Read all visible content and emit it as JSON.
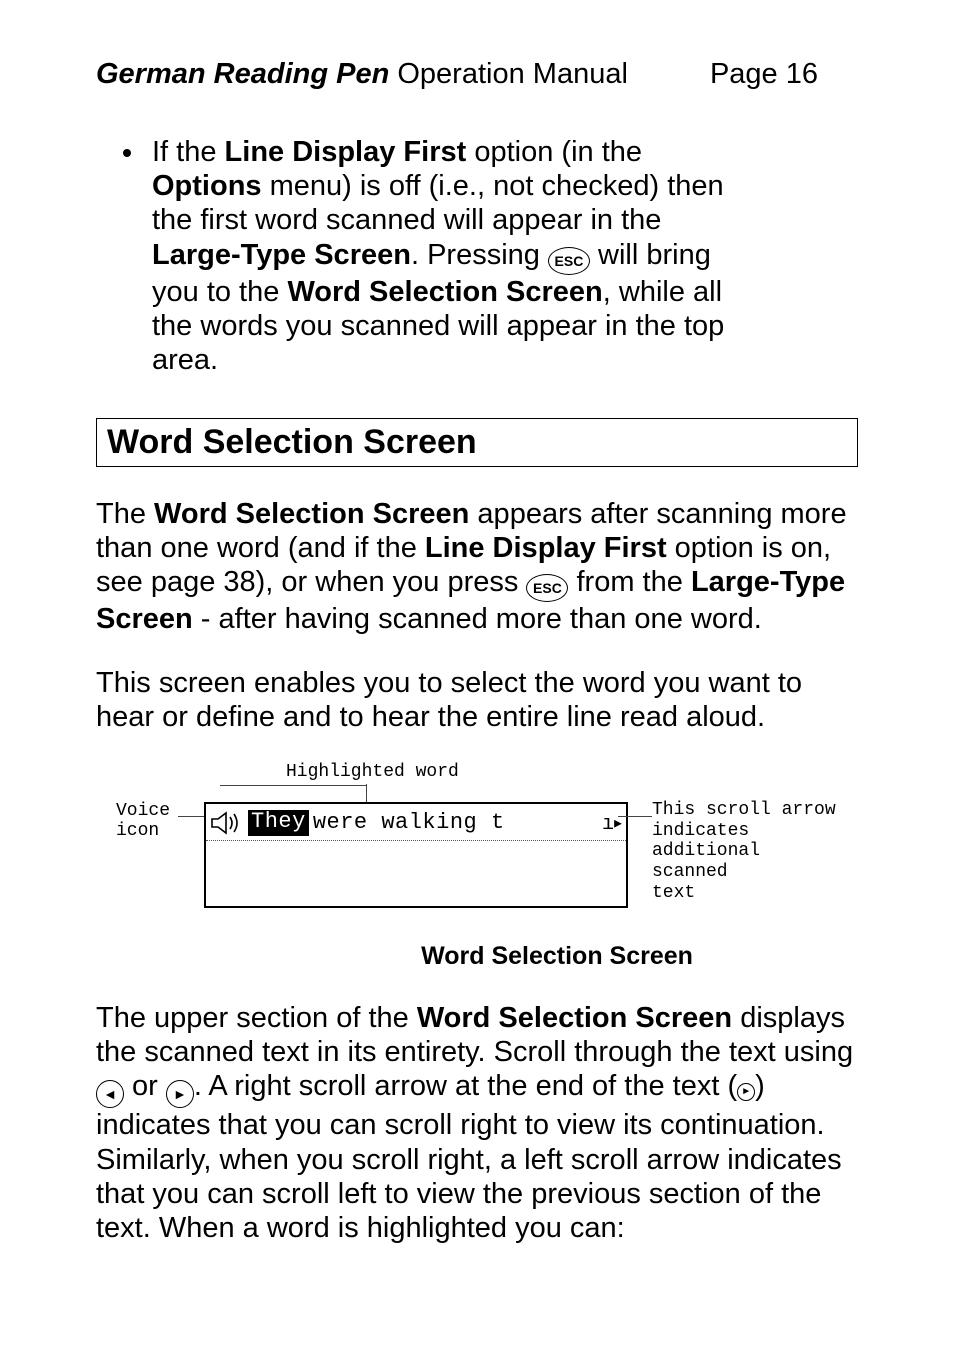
{
  "header": {
    "title_em": "German Reading Pen",
    "title_rest": " Operation Manual",
    "page_label": "Page 16"
  },
  "bullet": {
    "pre1": "If the ",
    "b1": "Line Display First",
    "post1": " option (in the ",
    "b2": "Options",
    "post2": " menu) is off (i.e., not checked) then the first word scanned will appear in the ",
    "b3": "Large-Type Screen",
    "post3": ". Pressing ",
    "esc": "ESC",
    "post4": " will bring you to the ",
    "b4": "Word Selection Screen",
    "post5": ", while all the words you scanned will appear in the top area."
  },
  "section_heading": "Word Selection Screen",
  "para1": {
    "t1": "The ",
    "b1": "Word Selection Screen",
    "t2": " appears after scanning more than one word (and if the ",
    "b2": "Line Display First",
    "t3": " option is on, see page 38), or when you press ",
    "esc": "ESC",
    "t4": " from the ",
    "b3": "Large-Type Screen",
    "t5": " - after having scanned more than one word."
  },
  "para2": "This screen enables you to select the word you want to hear or define and to hear the entire line read aloud.",
  "figure": {
    "highlighted_label": "Highlighted word",
    "voice_label_l1": "Voice",
    "voice_label_l2": "icon",
    "lcd_highlighted": "They",
    "lcd_rest": " were walking t",
    "scroll_label_l1": "This scroll arrow",
    "scroll_label_l2": "indicates",
    "scroll_label_l3": "additional",
    "scroll_label_l4": "scanned",
    "scroll_label_l5": "text",
    "caption": "Word Selection Screen"
  },
  "para3": {
    "t1": "The upper section of the ",
    "b1": "Word Selection Screen",
    "t2": " displays the scanned text in its entirety. Scroll through the text using ",
    "left_arrow": "◄",
    "t3": " or ",
    "right_arrow": "►",
    "t4": ". A right scroll arrow at the end of the text ",
    "mini_arrow": "►",
    "t5": " indicates that you can scroll right to view its continuation. Similarly, when you scroll right, a left scroll arrow indicates that you can scroll left to view the previous section of the text. When a word is highlighted you can:"
  }
}
